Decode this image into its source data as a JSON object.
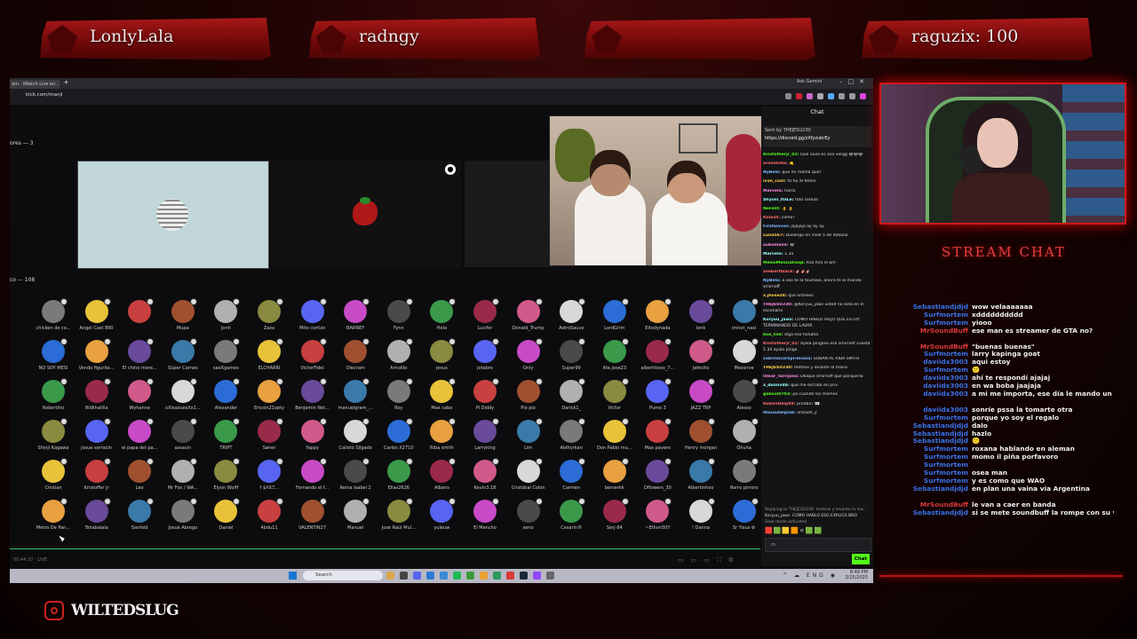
{
  "banners": [
    {
      "name": "LonlyLala"
    },
    {
      "name": "radngy"
    },
    {
      "name": ""
    },
    {
      "name": "raguzix: 100"
    }
  ],
  "browser": {
    "tab_label": "am · iWatch Live en ...",
    "url": "kick.com/manji",
    "gemini_label": "Ask Gemini"
  },
  "space": {
    "stage_label": "ores — 3",
    "listeners_label": "co — 108",
    "status": "00:44:37 · LIVE"
  },
  "listeners": [
    [
      "chicken de co...",
      "Angel Cast 890",
      "",
      "Mupa",
      "Jonh",
      "Zaza",
      "Mito cortizo",
      "BARNEY",
      "Fynn",
      "Hela",
      "Lucifer",
      "Donald_Trump",
      "AstroSauce",
      "LordGrim",
      "Eltodynada",
      "lonk",
      "imnot_nasi"
    ],
    [
      "NO SOY MESI",
      "Vendo figurita...",
      "El chino more...",
      "Súper Carnes",
      "saeXgames",
      "ELCHARRI",
      "VictorFidel",
      "Olecram",
      "Arnoldo",
      "jesus",
      "jotabro",
      "Only",
      "Super99",
      "itte.jose23",
      "albertitooo_7...",
      "Jafecito",
      "Messirve"
    ],
    [
      "Robertiño",
      "Wdkhalilla",
      "Wyhanne",
      "xXixazuesXx1...",
      "Alexander",
      "Ericsin21opty",
      "Benjamin Net...",
      "manuelgram_...",
      "Roy",
      "Max cabo",
      "Pi Diddy",
      "Pio pio",
      "Darick1_",
      "Victor",
      "Pumo 3",
      "JAZZ TRP",
      "Alesso"
    ],
    [
      "Shinji Kagawa",
      "josue serracin",
      "el papa del pa...",
      "assasin",
      "TRIPT",
      "Søren",
      "Yappy",
      "Calixto Silgado",
      "Carlos X2710",
      "Riba smith",
      "Larryking",
      "Lim",
      "Aldhyrkan",
      "Don Pablo mu...",
      "Max pavero",
      "Henry morgan",
      "Oñuña"
    ],
    [
      "Cristian",
      "Kristoffer jr",
      "Leo",
      "Mr Fox / WA...",
      "Elyon Wolff",
      "† $ΛXΞ...",
      "Fernando el f...",
      "Reina Isabel 2",
      "Elías2626",
      "Albens",
      "Kevin3.18",
      "Cristóbal Colón",
      "Carmen",
      "berserkk",
      "Dflowers_30",
      "Albertinhoo",
      "Rorro pirroro"
    ],
    [
      "Metro De Pan...",
      "Tshabalala",
      "Sanfold",
      "Josue Abrego",
      "Daniel",
      "4bdu11",
      "VALENTIN27",
      "Manuel",
      "José Raúl Mul...",
      "yuleuw",
      "El Mencho",
      "xeno",
      "Cesarin®",
      "Serj-84",
      "~Ethvn50Y",
      "! Danna",
      "Sr Yisus ⚙"
    ]
  ],
  "colors": [
    "#7a7a7a",
    "#5865f2",
    "#d8d8d8",
    "#e8c33a",
    "#c94ac7",
    "#2b6cd6",
    "#c84040",
    "#4a4a4a",
    "#e8a040",
    "#a05030",
    "#3a9a4a",
    "#6a4a9a",
    "#b0b0b0",
    "#9a2a4a",
    "#3a7aa8",
    "#8a8a40",
    "#d05a8a"
  ],
  "kick_chat": {
    "title": "Chat",
    "pinned_by": "Sent by THEJESU230",
    "pinned_link": "https://discord.gg/zXfyzubrEy",
    "messages": [
      {
        "u": "Kristofherjr_02:",
        "t": "Que xuxa es esa vergg 😂😂😂"
      },
      {
        "u": "ernesto66:",
        "t": "🤙"
      },
      {
        "u": "NyBelo:",
        "t": "que mi mamá que?"
      },
      {
        "u": "ivan_cool:",
        "t": "Yo fui al femni"
      },
      {
        "u": "Marvelo:",
        "t": "fuera"
      },
      {
        "u": "Shyoiii_ItaLe:",
        "t": "foto cedula"
      },
      {
        "u": "Nerolit:",
        "t": "👌 👌"
      },
      {
        "u": "Kiilash:",
        "t": "como?"
      },
      {
        "u": "Firstwaves:",
        "t": "jajajaja ay ay ay"
      },
      {
        "u": "Luna567:",
        "t": "Duolingo en nivel 5 de italiano"
      },
      {
        "u": "subomaliii:",
        "t": "😂"
      },
      {
        "u": "Marvelo:",
        "t": "1.35"
      },
      {
        "u": "MessiMessiahoop:",
        "t": "Rsa hiro el am"
      },
      {
        "u": "zeebertblack:",
        "t": "🎸🎸🎸"
      },
      {
        "u": "NyBelo:",
        "t": "a oso te la fourloko, ahora te lo mando smirnoff"
      },
      {
        "u": "x.jhose28:",
        "t": "que onteoos"
      },
      {
        "u": "THEJESU230:",
        "t": "@Koryuu_jaws usted no está en el escenario"
      },
      {
        "u": "Koryuu_jaws:",
        "t": "COMO HABLO VIEJO QUE ESTOY TERMINANDO DE LAVAR"
      },
      {
        "u": "koo_live:",
        "t": "olga eso hahaha"
      },
      {
        "u": "Kristofherjr_02:",
        "t": "Ayala pingaso esa smirnoff cuesta 1.34 ayala pinga"
      },
      {
        "u": "sabrinacaraprimiana:",
        "t": "SUBAN AL RIBA SMITH"
      },
      {
        "u": "THEJESU230:",
        "t": "metese y levante la mano"
      },
      {
        "u": "Omar_Tarrijons:",
        "t": "Dbique smirnoff que porquería"
      },
      {
        "u": "x_dunnvilb:",
        "t": "que me escriba en priv"
      },
      {
        "u": "gabusi0703:",
        "t": "pa cuando los memes"
      },
      {
        "u": "RubenDelp09:",
        "t": "pruebo? 👀"
      },
      {
        "u": "Wasautelplak:",
        "t": "imitaoh_y"
      }
    ],
    "reply_hint": "Replying to THEJESU230: metese y levante la ma...",
    "reply_line": "Koryuu_jaws: COMO HABLO ESO EXPLICA BRO",
    "slow_mode": "Slow mode activated",
    "input_value": "m",
    "chat_button": "Chat"
  },
  "taskbar": {
    "search": "Search",
    "time": "8:49 PM",
    "date": "3/25/2025",
    "lang": "ENG"
  },
  "stream_chat": {
    "title": "STREAM CHAT",
    "rows": [
      {
        "n": "Sebastiandjdjd",
        "t": "wow velaaaaaaa",
        "c": "#3a72e8"
      },
      {
        "n": "Surfmortem",
        "t": "xdddddddddd",
        "c": "#3a72e8"
      },
      {
        "n": "Surfmortem",
        "t": "yiooo",
        "c": "#3a72e8"
      },
      {
        "n": "MrSoundBuff",
        "t": "ese man es streamer de GTA no?",
        "c": "#d83a3a"
      },
      {
        "n": "",
        "t": "",
        "c": "#d83a3a"
      },
      {
        "n": "MrSoundBuff",
        "t": "\"buenas buenas\"",
        "c": "#d83a3a"
      },
      {
        "n": "Surfmortem",
        "t": "larry kapinga goat",
        "c": "#3a72e8"
      },
      {
        "n": "daviidx3003",
        "t": "aqui estoy",
        "c": "#3a72e8"
      },
      {
        "n": "Surfmortem",
        "t": "🙂",
        "c": "#3a72e8"
      },
      {
        "n": "daviidx3003",
        "t": "ahí te respondí ajajaj",
        "c": "#3a72e8"
      },
      {
        "n": "daviidx3003",
        "t": "en wa boba jaajaja",
        "c": "#3a72e8"
      },
      {
        "n": "daviidx3003",
        "t": "a mi me importa, ese día le mando un regalo",
        "c": "#3a72e8"
      },
      {
        "n": "",
        "t": "",
        "c": "#3a72e8"
      },
      {
        "n": "daviidx3003",
        "t": "sonríe pssa la tomarte otra",
        "c": "#3a72e8"
      },
      {
        "n": "Surfmortem",
        "t": "porque yo soy el regalo",
        "c": "#3a72e8"
      },
      {
        "n": "Sebastiandjdjd",
        "t": "dalo",
        "c": "#3a72e8"
      },
      {
        "n": "Sebastiandjdjd",
        "t": "hazlo",
        "c": "#3a72e8"
      },
      {
        "n": "Sebastiandjdjd",
        "t": "🙂",
        "c": "#3a72e8"
      },
      {
        "n": "Surfmortem",
        "t": "roxana hablando en aleman",
        "c": "#3a72e8"
      },
      {
        "n": "Surfmortem",
        "t": "momo il piña porfavoro",
        "c": "#3a72e8"
      },
      {
        "n": "Surfmortem",
        "t": "",
        "c": "#3a72e8"
      },
      {
        "n": "Surfmortem",
        "t": "osea man",
        "c": "#3a72e8"
      },
      {
        "n": "Surfmortem",
        "t": "y es como que WAO",
        "c": "#3a72e8"
      },
      {
        "n": "Sebastiandjdjd",
        "t": "en plan una vaina via Argentina",
        "c": "#3a72e8"
      },
      {
        "n": "",
        "t": "",
        "c": "#3a72e8"
      },
      {
        "n": "MrSoundBuff",
        "t": "le van a caer en banda",
        "c": "#d83a3a"
      },
      {
        "n": "Sebastiandjdjd",
        "t": "si se mete soundbuff la rompe con su voz",
        "c": "#3a72e8"
      }
    ]
  },
  "brand": {
    "name": "WILTEDSLUG"
  }
}
